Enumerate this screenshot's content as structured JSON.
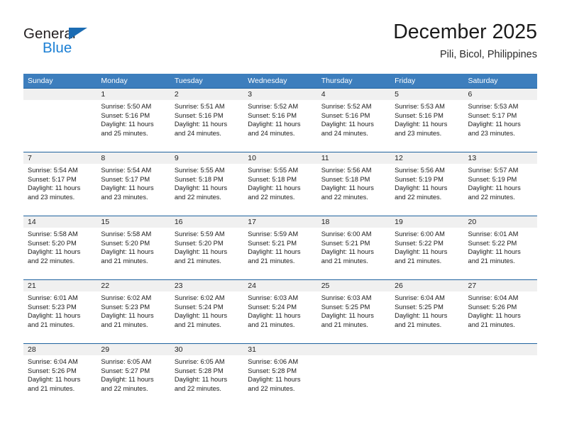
{
  "logo": {
    "word_top": "General",
    "word_bottom": "Blue",
    "triangle_color": "#1c6cb3",
    "blue_color": "#1b7fd4",
    "dark_color": "#231f20"
  },
  "header": {
    "title": "December 2025",
    "subtitle": "Pili, Bicol, Philippines"
  },
  "theme": {
    "header_bg": "#3d7ebd",
    "header_text": "#ffffff",
    "row_rule": "#20639f",
    "daynum_band": "#f0f0f0",
    "cell_bg": "#ffffff"
  },
  "weekday_headers": [
    "Sunday",
    "Monday",
    "Tuesday",
    "Wednesday",
    "Thursday",
    "Friday",
    "Saturday"
  ],
  "weeks": [
    [
      {
        "day": "",
        "empty": true,
        "sunrise": "",
        "sunset": "",
        "daylight_1": "",
        "daylight_2": ""
      },
      {
        "day": "1",
        "sunrise": "Sunrise: 5:50 AM",
        "sunset": "Sunset: 5:16 PM",
        "daylight_1": "Daylight: 11 hours",
        "daylight_2": "and 25 minutes."
      },
      {
        "day": "2",
        "sunrise": "Sunrise: 5:51 AM",
        "sunset": "Sunset: 5:16 PM",
        "daylight_1": "Daylight: 11 hours",
        "daylight_2": "and 24 minutes."
      },
      {
        "day": "3",
        "sunrise": "Sunrise: 5:52 AM",
        "sunset": "Sunset: 5:16 PM",
        "daylight_1": "Daylight: 11 hours",
        "daylight_2": "and 24 minutes."
      },
      {
        "day": "4",
        "sunrise": "Sunrise: 5:52 AM",
        "sunset": "Sunset: 5:16 PM",
        "daylight_1": "Daylight: 11 hours",
        "daylight_2": "and 24 minutes."
      },
      {
        "day": "5",
        "sunrise": "Sunrise: 5:53 AM",
        "sunset": "Sunset: 5:16 PM",
        "daylight_1": "Daylight: 11 hours",
        "daylight_2": "and 23 minutes."
      },
      {
        "day": "6",
        "sunrise": "Sunrise: 5:53 AM",
        "sunset": "Sunset: 5:17 PM",
        "daylight_1": "Daylight: 11 hours",
        "daylight_2": "and 23 minutes."
      }
    ],
    [
      {
        "day": "7",
        "sunrise": "Sunrise: 5:54 AM",
        "sunset": "Sunset: 5:17 PM",
        "daylight_1": "Daylight: 11 hours",
        "daylight_2": "and 23 minutes."
      },
      {
        "day": "8",
        "sunrise": "Sunrise: 5:54 AM",
        "sunset": "Sunset: 5:17 PM",
        "daylight_1": "Daylight: 11 hours",
        "daylight_2": "and 23 minutes."
      },
      {
        "day": "9",
        "sunrise": "Sunrise: 5:55 AM",
        "sunset": "Sunset: 5:18 PM",
        "daylight_1": "Daylight: 11 hours",
        "daylight_2": "and 22 minutes."
      },
      {
        "day": "10",
        "sunrise": "Sunrise: 5:55 AM",
        "sunset": "Sunset: 5:18 PM",
        "daylight_1": "Daylight: 11 hours",
        "daylight_2": "and 22 minutes."
      },
      {
        "day": "11",
        "sunrise": "Sunrise: 5:56 AM",
        "sunset": "Sunset: 5:18 PM",
        "daylight_1": "Daylight: 11 hours",
        "daylight_2": "and 22 minutes."
      },
      {
        "day": "12",
        "sunrise": "Sunrise: 5:56 AM",
        "sunset": "Sunset: 5:19 PM",
        "daylight_1": "Daylight: 11 hours",
        "daylight_2": "and 22 minutes."
      },
      {
        "day": "13",
        "sunrise": "Sunrise: 5:57 AM",
        "sunset": "Sunset: 5:19 PM",
        "daylight_1": "Daylight: 11 hours",
        "daylight_2": "and 22 minutes."
      }
    ],
    [
      {
        "day": "14",
        "sunrise": "Sunrise: 5:58 AM",
        "sunset": "Sunset: 5:20 PM",
        "daylight_1": "Daylight: 11 hours",
        "daylight_2": "and 22 minutes."
      },
      {
        "day": "15",
        "sunrise": "Sunrise: 5:58 AM",
        "sunset": "Sunset: 5:20 PM",
        "daylight_1": "Daylight: 11 hours",
        "daylight_2": "and 21 minutes."
      },
      {
        "day": "16",
        "sunrise": "Sunrise: 5:59 AM",
        "sunset": "Sunset: 5:20 PM",
        "daylight_1": "Daylight: 11 hours",
        "daylight_2": "and 21 minutes."
      },
      {
        "day": "17",
        "sunrise": "Sunrise: 5:59 AM",
        "sunset": "Sunset: 5:21 PM",
        "daylight_1": "Daylight: 11 hours",
        "daylight_2": "and 21 minutes."
      },
      {
        "day": "18",
        "sunrise": "Sunrise: 6:00 AM",
        "sunset": "Sunset: 5:21 PM",
        "daylight_1": "Daylight: 11 hours",
        "daylight_2": "and 21 minutes."
      },
      {
        "day": "19",
        "sunrise": "Sunrise: 6:00 AM",
        "sunset": "Sunset: 5:22 PM",
        "daylight_1": "Daylight: 11 hours",
        "daylight_2": "and 21 minutes."
      },
      {
        "day": "20",
        "sunrise": "Sunrise: 6:01 AM",
        "sunset": "Sunset: 5:22 PM",
        "daylight_1": "Daylight: 11 hours",
        "daylight_2": "and 21 minutes."
      }
    ],
    [
      {
        "day": "21",
        "sunrise": "Sunrise: 6:01 AM",
        "sunset": "Sunset: 5:23 PM",
        "daylight_1": "Daylight: 11 hours",
        "daylight_2": "and 21 minutes."
      },
      {
        "day": "22",
        "sunrise": "Sunrise: 6:02 AM",
        "sunset": "Sunset: 5:23 PM",
        "daylight_1": "Daylight: 11 hours",
        "daylight_2": "and 21 minutes."
      },
      {
        "day": "23",
        "sunrise": "Sunrise: 6:02 AM",
        "sunset": "Sunset: 5:24 PM",
        "daylight_1": "Daylight: 11 hours",
        "daylight_2": "and 21 minutes."
      },
      {
        "day": "24",
        "sunrise": "Sunrise: 6:03 AM",
        "sunset": "Sunset: 5:24 PM",
        "daylight_1": "Daylight: 11 hours",
        "daylight_2": "and 21 minutes."
      },
      {
        "day": "25",
        "sunrise": "Sunrise: 6:03 AM",
        "sunset": "Sunset: 5:25 PM",
        "daylight_1": "Daylight: 11 hours",
        "daylight_2": "and 21 minutes."
      },
      {
        "day": "26",
        "sunrise": "Sunrise: 6:04 AM",
        "sunset": "Sunset: 5:25 PM",
        "daylight_1": "Daylight: 11 hours",
        "daylight_2": "and 21 minutes."
      },
      {
        "day": "27",
        "sunrise": "Sunrise: 6:04 AM",
        "sunset": "Sunset: 5:26 PM",
        "daylight_1": "Daylight: 11 hours",
        "daylight_2": "and 21 minutes."
      }
    ],
    [
      {
        "day": "28",
        "sunrise": "Sunrise: 6:04 AM",
        "sunset": "Sunset: 5:26 PM",
        "daylight_1": "Daylight: 11 hours",
        "daylight_2": "and 21 minutes."
      },
      {
        "day": "29",
        "sunrise": "Sunrise: 6:05 AM",
        "sunset": "Sunset: 5:27 PM",
        "daylight_1": "Daylight: 11 hours",
        "daylight_2": "and 22 minutes."
      },
      {
        "day": "30",
        "sunrise": "Sunrise: 6:05 AM",
        "sunset": "Sunset: 5:28 PM",
        "daylight_1": "Daylight: 11 hours",
        "daylight_2": "and 22 minutes."
      },
      {
        "day": "31",
        "sunrise": "Sunrise: 6:06 AM",
        "sunset": "Sunset: 5:28 PM",
        "daylight_1": "Daylight: 11 hours",
        "daylight_2": "and 22 minutes."
      },
      {
        "day": "",
        "empty": true,
        "sunrise": "",
        "sunset": "",
        "daylight_1": "",
        "daylight_2": ""
      },
      {
        "day": "",
        "empty": true,
        "sunrise": "",
        "sunset": "",
        "daylight_1": "",
        "daylight_2": ""
      },
      {
        "day": "",
        "empty": true,
        "sunrise": "",
        "sunset": "",
        "daylight_1": "",
        "daylight_2": ""
      }
    ]
  ]
}
